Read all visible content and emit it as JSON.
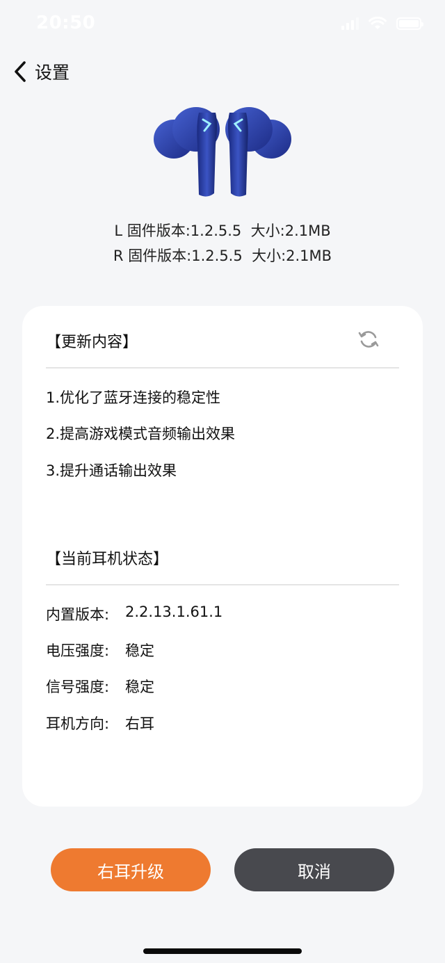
{
  "status_bar": {
    "time": "20:50"
  },
  "nav": {
    "back_label": "设置"
  },
  "firmware": {
    "left": "L 固件版本:1.2.5.5  大小:2.1MB",
    "right": "R 固件版本:1.2.5.5  大小:2.1MB"
  },
  "update_section": {
    "title": "【更新内容】",
    "items": [
      "1.优化了蓝牙连接的稳定性",
      "2.提高游戏模式音频输出效果",
      "3.提升通话输出效果"
    ]
  },
  "status_section": {
    "title": "【当前耳机状态】",
    "rows": [
      {
        "label": "内置版本:",
        "value": "2.2.13.1.61.1"
      },
      {
        "label": "电压强度:",
        "value": "稳定"
      },
      {
        "label": "信号强度:",
        "value": "稳定"
      },
      {
        "label": "耳机方向:",
        "value": "右耳"
      }
    ]
  },
  "buttons": {
    "upgrade": "右耳升级",
    "cancel": "取消"
  },
  "colors": {
    "accent": "#ee7a30",
    "cancel": "#48494e",
    "earbud": "#2b3fa8"
  },
  "icons": [
    "chevron-left-icon",
    "refresh-icon",
    "wifi-icon",
    "signal-icon",
    "battery-icon"
  ]
}
